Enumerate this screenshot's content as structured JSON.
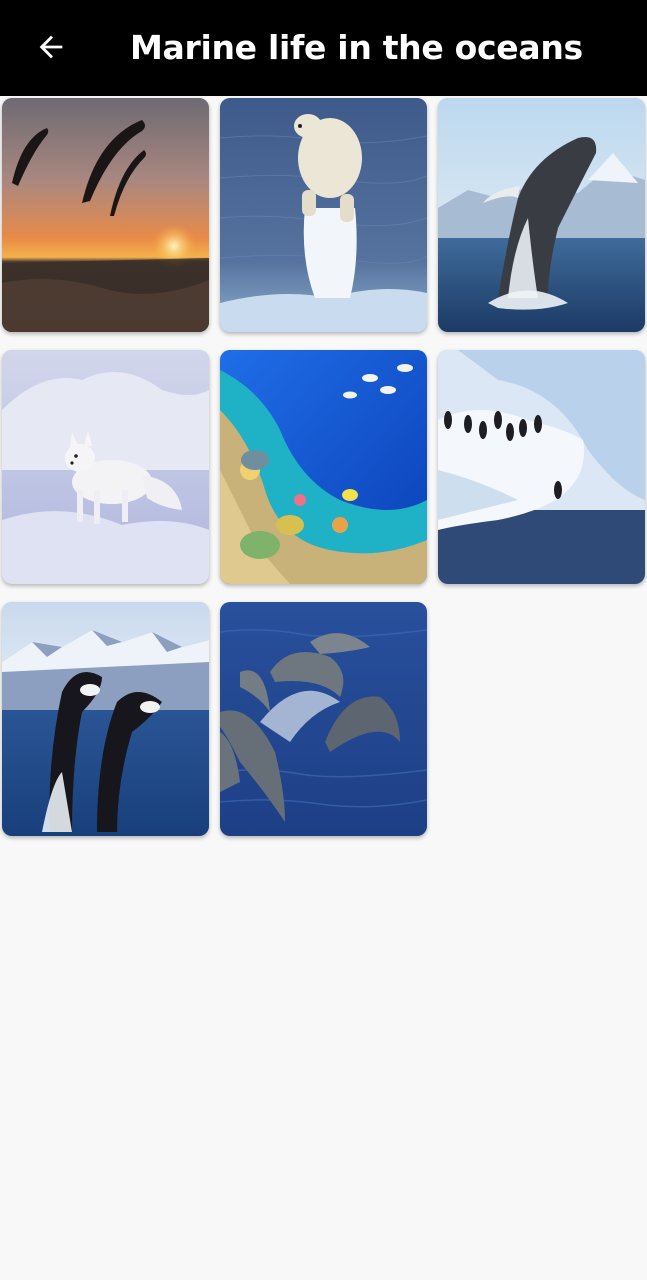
{
  "appbar": {
    "title": "Marine life in the oceans",
    "back_icon": "arrow-left-icon"
  },
  "gallery": {
    "items": [
      {
        "subject": "dolphin-silhouettes-sunset"
      },
      {
        "subject": "polar-bear-on-ice"
      },
      {
        "subject": "humpback-whale-breach"
      },
      {
        "subject": "arctic-fox-snow"
      },
      {
        "subject": "coral-reef-fish"
      },
      {
        "subject": "penguins-on-iceberg"
      },
      {
        "subject": "orcas-jumping"
      },
      {
        "subject": "dolphins-leaping"
      }
    ]
  },
  "colors": {
    "appbar_bg": "#000000",
    "appbar_text": "#ffffff",
    "page_bg": "#f8f8f8"
  }
}
